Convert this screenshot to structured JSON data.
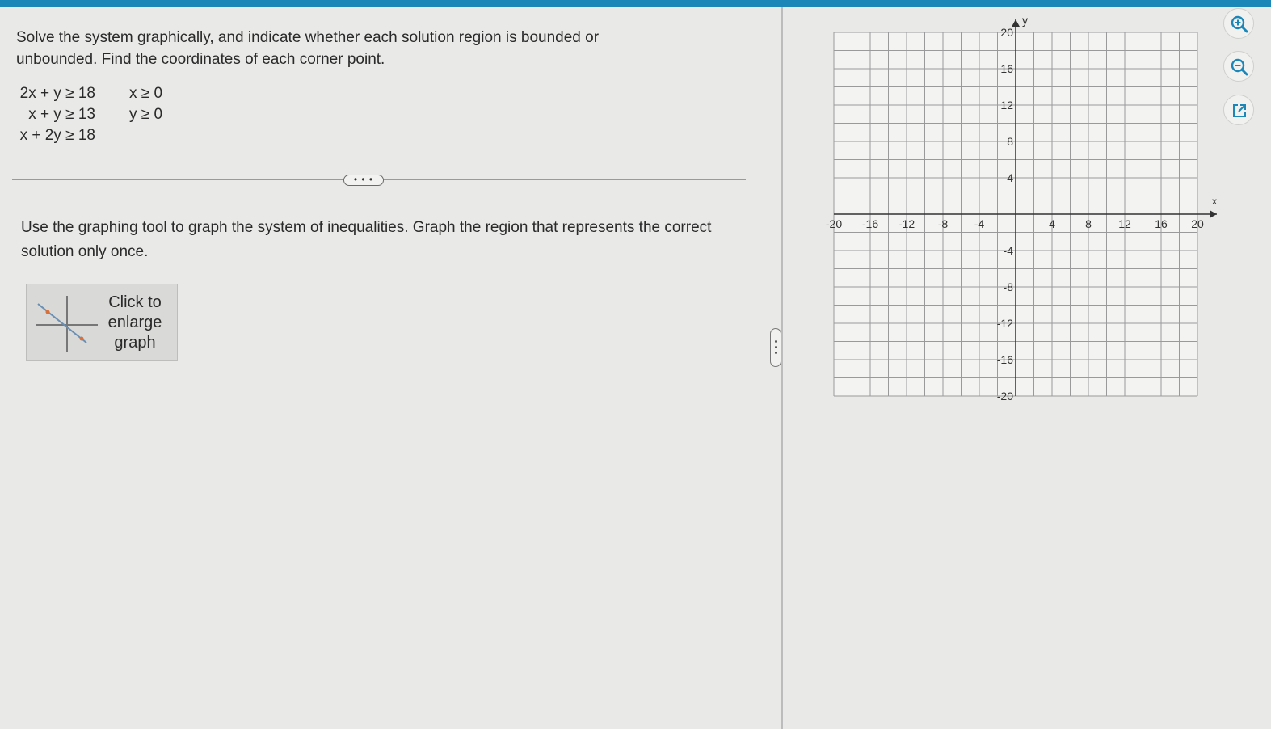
{
  "problem": {
    "text": "Solve the system graphically, and indicate whether each solution region is bounded or unbounded. Find the coordinates of each corner point.",
    "inequalities_left": [
      "2x + y ≥ 18",
      "x + y ≥ 13",
      "x + 2y ≥ 18"
    ],
    "inequalities_right": [
      "x ≥ 0",
      "y ≥ 0"
    ]
  },
  "more_button": {
    "label": "• • •"
  },
  "instructions": "Use the graphing tool to graph the system of inequalities. Graph the region that represents the correct solution only once.",
  "enlarge_button": {
    "lines": [
      "Click to",
      "enlarge",
      "graph"
    ]
  },
  "graph": {
    "x_axis_label": "x",
    "y_axis_label": "y",
    "x_ticks": [
      "-20",
      "-16",
      "-12",
      "-8",
      "-4",
      "4",
      "8",
      "12",
      "16",
      "20"
    ],
    "y_ticks": [
      "20",
      "16",
      "12",
      "8",
      "4",
      "-4",
      "-8",
      "-12",
      "-16",
      "-20"
    ],
    "range": [
      -20,
      20
    ],
    "grid_step": 2,
    "label_step": 4
  },
  "tools": {
    "zoom_in": "zoom-in-icon",
    "zoom_out": "zoom-out-icon",
    "open_external": "external-link-icon"
  },
  "colors": {
    "accent": "#1b86b8",
    "grid": "#9a9a9a",
    "axis": "#333333"
  }
}
